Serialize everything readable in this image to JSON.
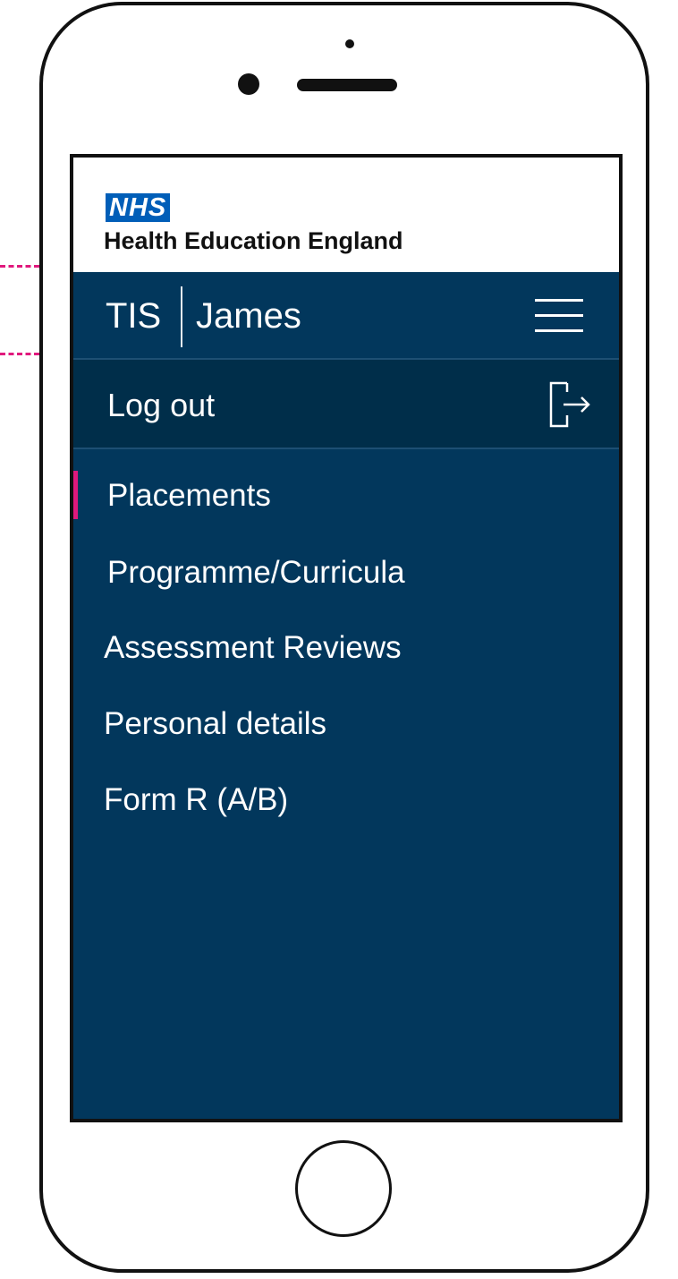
{
  "branding": {
    "logo_text": "NHS",
    "org_name": "Health Education England"
  },
  "app_bar": {
    "app_name": "TIS",
    "user_name": "James",
    "menu_icon": "hamburger-menu-icon"
  },
  "logout": {
    "label": "Log out",
    "icon": "logout-icon"
  },
  "nav": {
    "active_index": 0,
    "items": [
      {
        "label": "Placements"
      },
      {
        "label": "Programme/Curricula"
      },
      {
        "label": "Assessment Reviews"
      },
      {
        "label": "Personal details"
      },
      {
        "label": "Form R (A/B)"
      }
    ]
  },
  "colors": {
    "nav_background": "#02375c",
    "logout_background": "#002e4a",
    "nhs_blue": "#005eb8",
    "active_indicator": "#e0197d"
  }
}
